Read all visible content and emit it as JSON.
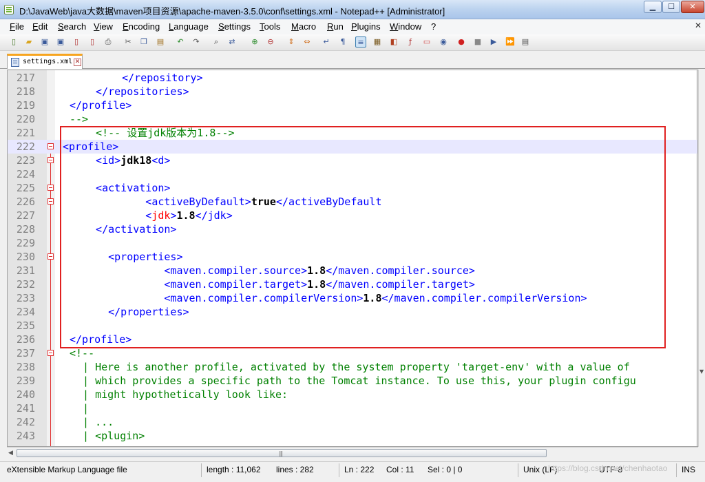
{
  "window": {
    "title": "D:\\JavaWeb\\java大数据\\maven项目资源\\apache-maven-3.5.0\\conf\\settings.xml - Notepad++ [Administrator]",
    "min_glyph": "▁",
    "max_glyph": "☐",
    "close_glyph": "✕"
  },
  "menu": [
    "File",
    "Edit",
    "Search",
    "View",
    "Encoding",
    "Language",
    "Settings",
    "Tools",
    "Macro",
    "Run",
    "Plugins",
    "Window",
    "?"
  ],
  "menu_close_glyph": "✕",
  "toolbar_icons": [
    "new-file-icon",
    "open-file-icon",
    "save-icon",
    "save-all-icon",
    "close-icon",
    "close-all-icon",
    "print-icon",
    "cut-icon",
    "copy-icon",
    "paste-icon",
    "undo-icon",
    "redo-icon",
    "find-icon",
    "replace-icon",
    "zoom-in-icon",
    "zoom-out-icon",
    "sync-vertical-icon",
    "sync-horizontal-icon",
    "word-wrap-icon",
    "show-all-chars-icon",
    "indent-guide-icon",
    "user-lang-icon",
    "doc-map-icon",
    "function-list-icon",
    "folder-workspace-icon",
    "monitor-icon",
    "record-macro-icon",
    "stop-macro-icon",
    "play-macro-icon",
    "run-macro-multiple-icon",
    "save-macro-icon"
  ],
  "tab": {
    "label": "settings.xml",
    "close_glyph": "✕"
  },
  "colors": {
    "tag": "#0000ff",
    "comment": "#008000",
    "highlight_box": "#e02020",
    "current_line": "#e8e8ff"
  },
  "lines": [
    {
      "n": "217",
      "fold": false,
      "parts": [
        [
          "t",
          "    </repository>"
        ]
      ]
    },
    {
      "n": "218",
      "fold": false,
      "parts": [
        [
          "t",
          "  </repositories>"
        ]
      ]
    },
    {
      "n": "219",
      "fold": false,
      "parts": [
        [
          "t",
          "</profile>"
        ]
      ]
    },
    {
      "n": "220",
      "fold": false,
      "parts": [
        [
          "c",
          "-->"
        ]
      ]
    },
    {
      "n": "221",
      "fold": false,
      "parts": [
        [
          "c",
          "  <!-- 设置jdk版本为1.8-->"
        ]
      ]
    },
    {
      "n": "222",
      "fold": true,
      "current": true,
      "indent": -3,
      "parts": [
        [
          "t",
          "<profile>"
        ]
      ]
    },
    {
      "n": "223",
      "fold": true,
      "parts": [
        [
          "t",
          "  <id>"
        ],
        [
          "v",
          "jdk18"
        ],
        [
          "t",
          "<d>"
        ]
      ]
    },
    {
      "n": "224",
      "fold": false,
      "parts": [
        [
          "p",
          ""
        ]
      ]
    },
    {
      "n": "225",
      "fold": true,
      "parts": [
        [
          "t",
          "  <activation>"
        ]
      ]
    },
    {
      "n": "226",
      "fold": true,
      "parts": [
        [
          "t",
          "          <activeByDefault>"
        ],
        [
          "v",
          "true"
        ],
        [
          "t",
          "</activeByDefault"
        ]
      ]
    },
    {
      "n": "227",
      "fold": false,
      "parts": [
        [
          "t",
          "          <"
        ],
        [
          "r",
          "jdk"
        ],
        [
          "t",
          ">"
        ],
        [
          "v",
          "1.8"
        ],
        [
          "t",
          "</jdk>"
        ]
      ]
    },
    {
      "n": "228",
      "fold": false,
      "parts": [
        [
          "t",
          "  </activation>"
        ]
      ]
    },
    {
      "n": "229",
      "fold": false,
      "parts": [
        [
          "p",
          ""
        ]
      ]
    },
    {
      "n": "230",
      "fold": true,
      "parts": [
        [
          "t",
          "    <properties>"
        ]
      ]
    },
    {
      "n": "231",
      "fold": false,
      "parts": [
        [
          "t",
          "             <maven.compiler.source>"
        ],
        [
          "v",
          "1.8"
        ],
        [
          "t",
          "</maven.compiler.source>"
        ]
      ]
    },
    {
      "n": "232",
      "fold": false,
      "parts": [
        [
          "t",
          "             <maven.compiler.target>"
        ],
        [
          "v",
          "1.8"
        ],
        [
          "t",
          "</maven.compiler.target>"
        ]
      ]
    },
    {
      "n": "233",
      "fold": false,
      "parts": [
        [
          "t",
          "             <maven.compiler.compilerVersion>"
        ],
        [
          "v",
          "1.8"
        ],
        [
          "t",
          "</maven.compiler.compilerVersion>"
        ]
      ]
    },
    {
      "n": "234",
      "fold": false,
      "parts": [
        [
          "t",
          "    </properties>"
        ]
      ]
    },
    {
      "n": "235",
      "fold": false,
      "parts": [
        [
          "p",
          ""
        ]
      ]
    },
    {
      "n": "236",
      "fold": false,
      "parts": [
        [
          "t",
          "</profile>"
        ]
      ]
    },
    {
      "n": "237",
      "fold": true,
      "parts": [
        [
          "c",
          "<!--"
        ]
      ]
    },
    {
      "n": "238",
      "fold": false,
      "parts": [
        [
          "c",
          " | Here is another profile, activated by the system property 'target-env' with a value of"
        ]
      ]
    },
    {
      "n": "239",
      "fold": false,
      "parts": [
        [
          "c",
          " | which provides a specific path to the Tomcat instance. To use this, your plugin configu"
        ]
      ]
    },
    {
      "n": "240",
      "fold": false,
      "parts": [
        [
          "c",
          " | might hypothetically look like:"
        ]
      ]
    },
    {
      "n": "241",
      "fold": false,
      "parts": [
        [
          "c",
          " |"
        ]
      ]
    },
    {
      "n": "242",
      "fold": false,
      "parts": [
        [
          "c",
          " | ..."
        ]
      ]
    },
    {
      "n": "243",
      "fold": false,
      "parts": [
        [
          "c",
          " | <plugin>"
        ]
      ]
    }
  ],
  "status": {
    "file_type": "eXtensible Markup Language file",
    "length": "length : 11,062",
    "lines": "lines : 282",
    "ln": "Ln : 222",
    "col": "Col : 11",
    "sel": "Sel : 0 | 0",
    "eol": "Unix (LF)",
    "encoding": "UTF-8",
    "mode": "INS"
  },
  "watermark": "https://blog.csdn.net/chenhaotao"
}
